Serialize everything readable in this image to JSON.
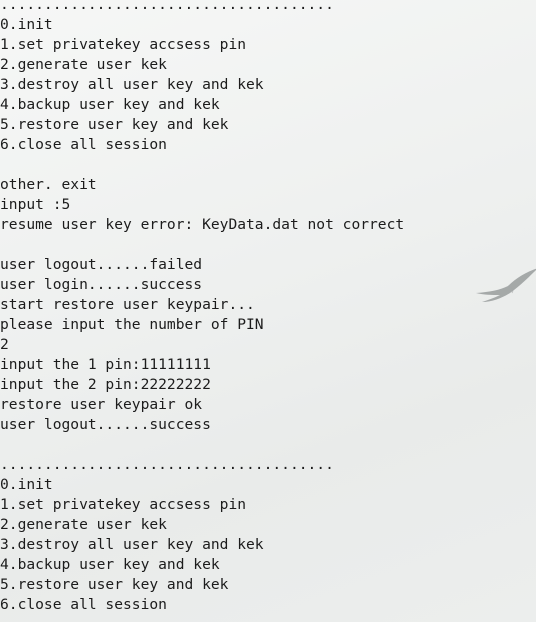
{
  "console": {
    "lines": [
      "......................................",
      "0.init",
      "1.set privatekey accsess pin",
      "2.generate user kek",
      "3.destroy all user key and kek",
      "4.backup user key and kek",
      "5.restore user key and kek",
      "6.close all session",
      "",
      "other. exit",
      "input :5",
      "resume user key error: KeyData.dat not correct",
      "",
      "user logout......failed",
      "user login......success",
      "start restore user keypair...",
      "please input the number of PIN",
      "2",
      "input the 1 pin:11111111",
      "input the 2 pin:22222222",
      "restore user keypair ok",
      "user logout......success",
      "",
      "......................................",
      "0.init",
      "1.set privatekey accsess pin",
      "2.generate user kek",
      "3.destroy all user key and kek",
      "4.backup user key and kek",
      "5.restore user key and kek",
      "6.close all session"
    ]
  },
  "wallpaper": {
    "icon": "bird-silhouette-icon"
  }
}
